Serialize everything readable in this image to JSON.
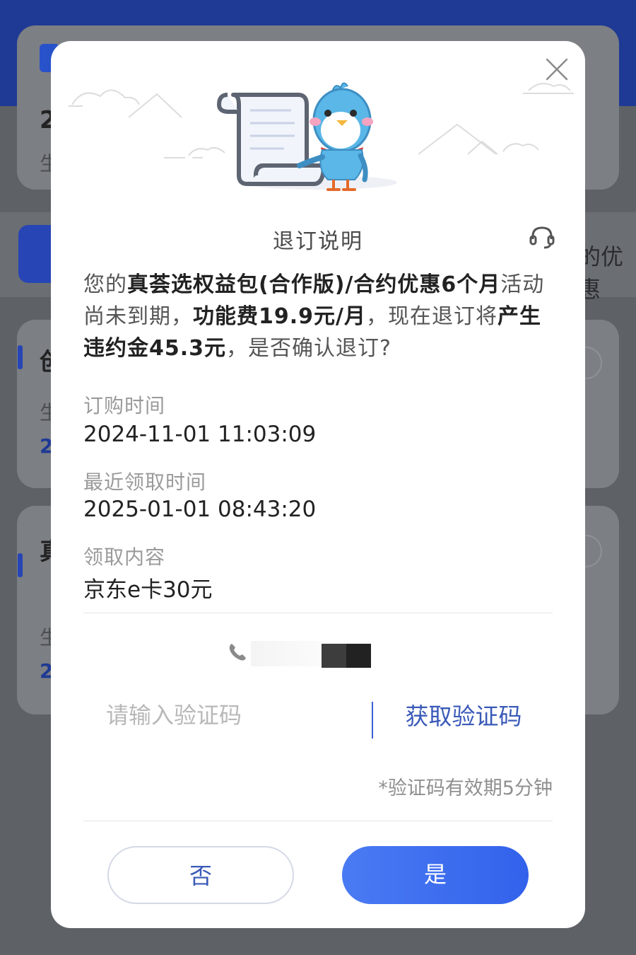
{
  "background": {
    "tab_partial_text": "的优惠",
    "card_partial_chars": [
      "2",
      "生",
      "创",
      "生",
      "2",
      "真",
      "生",
      "2"
    ]
  },
  "dialog": {
    "title": "退订说明",
    "message": {
      "p1": "您的",
      "product": "真荟选权益包(合作版)/合约优惠6个月",
      "p2": "活动尚未到期，",
      "fee": "功能费19.9元/月",
      "p3": "，现在退订将",
      "penalty": "产生违约金45.3元",
      "p4": "，是否确认退订?"
    },
    "fields": [
      {
        "label": "订购时间",
        "value": "2024-11-01 11:03:09"
      },
      {
        "label": "最近领取时间",
        "value": "2025-01-01 08:43:20"
      },
      {
        "label": "领取内容",
        "value": "京东e卡30元"
      }
    ],
    "code_input_placeholder": "请输入验证码",
    "code_input_value": "",
    "get_code_label": "获取验证码",
    "validity_note": "*验证码有效期5分钟",
    "no_label": "否",
    "yes_label": "是"
  },
  "icons": {
    "close": "close-icon",
    "service": "customer-service-icon",
    "phone": "phone-icon",
    "illustration": "bird-scroll-illustration"
  },
  "colors": {
    "accent": "#3262eb",
    "link": "#3a5ab8",
    "header_bg": "#1f3a94"
  }
}
